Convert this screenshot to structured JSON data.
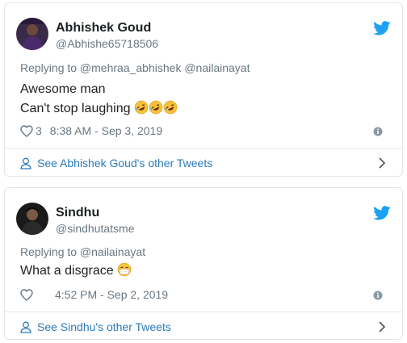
{
  "tweets": [
    {
      "name": "Abhishek Goud",
      "handle": "@Abhishe65718506",
      "reply": "Replying to @mehraa_abhishek @nailainayat",
      "lines": [
        "Awesome man",
        "Can't stop laughing"
      ],
      "emojis": [
        "rolling-on-floor-laughing",
        "rolling-on-floor-laughing",
        "rolling-on-floor-laughing"
      ],
      "likes": "3",
      "timestamp": "8:38 AM - Sep 3, 2019",
      "footer_link": "See Abhishek Goud's other Tweets"
    },
    {
      "name": "Sindhu",
      "handle": "@sindhutatsme",
      "reply": "Replying to @nailainayat",
      "lines": [
        "What a disgrace"
      ],
      "emojis": [
        "face-with-medical-mask"
      ],
      "likes": "",
      "timestamp": "4:52 PM - Sep 2, 2019",
      "footer_link": "See Sindhu's other Tweets"
    }
  ],
  "colors": {
    "link": "#2b7bb9",
    "muted": "#697882",
    "border": "#e1e8ed",
    "twitter_blue": "#1da1f2"
  }
}
